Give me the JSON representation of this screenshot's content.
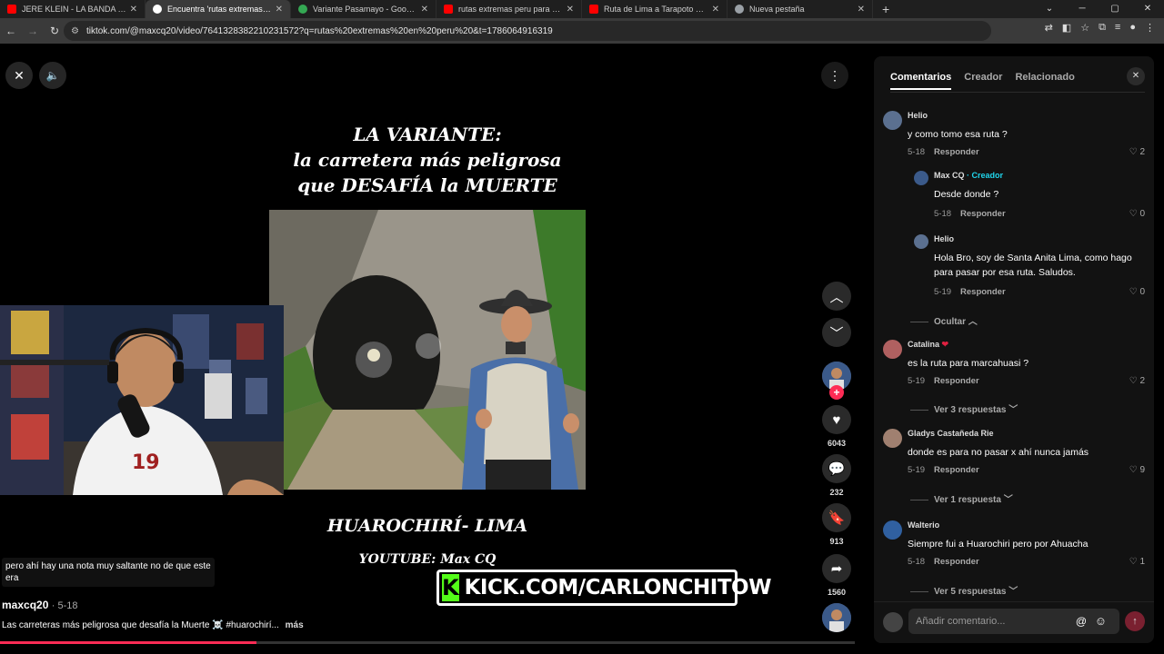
{
  "browser": {
    "tabs": [
      {
        "title": "JERE KLEIN - LA BANDA (Letra/",
        "color": "#ff0000"
      },
      {
        "title": "Encuentra 'rutas extremas en p",
        "color": "#ffffff"
      },
      {
        "title": "Variante Pasamayo - Google M",
        "color": "#34a853"
      },
      {
        "title": "rutas extremas peru para biker",
        "color": "#ff0000"
      },
      {
        "title": "Ruta de Lima a Tarapoto en mo",
        "color": "#ff0000"
      },
      {
        "title": "Nueva pestaña",
        "color": "#9aa0a6"
      }
    ],
    "url": "tiktok.com/@maxcq20/video/7641328382210231572?q=rutas%20extremas%20en%20peru%20&t=1786064916319"
  },
  "video": {
    "title_lines": [
      "LA VARIANTE:",
      "la carretera más peligrosa",
      "que DESAFÍA la MUERTE"
    ],
    "subtitle": "HUAROCHIRÍ- LIMA",
    "youtube": "YOUTUBE: Max CQ",
    "kick_text": "KICK.COM/CARLONCHITOW",
    "kick_icon": "K",
    "overlay_note": "pero ahí hay una nota muy saltante no de que este era",
    "author": "maxcq20",
    "date": "5-18",
    "description": "Las carreteras más peligrosa que desafía la Muerte ☠️ #huarochirí...",
    "more": "más",
    "progress": 0.3
  },
  "actions": {
    "likes": "6043",
    "comments": "232",
    "saves": "913",
    "shares": "1560"
  },
  "panel": {
    "tabs": [
      "Comentarios",
      "Creador",
      "Relacionado"
    ],
    "reply_label": "Responder",
    "comments": [
      {
        "name": "Helio",
        "text": "y como tomo esa ruta ?",
        "date": "5-18",
        "likes": "2"
      },
      {
        "name": "Catalina",
        "text": "es la ruta para marcahuasi ?",
        "date": "5-19",
        "likes": "2"
      },
      {
        "name": "Gladys Castañeda Rie",
        "text": "donde es para no pasar x ahí nunca jamás",
        "date": "5-19",
        "likes": "9"
      },
      {
        "name": "Walterio",
        "text": "Siempre fui a Huarochiri pero por Ahuacha",
        "date": "5-18",
        "likes": "1"
      }
    ],
    "replies": [
      {
        "name": "Max CQ",
        "badge": "· Creador",
        "text": "Desde donde ?",
        "date": "5-18",
        "likes": "0"
      },
      {
        "name": "Helio",
        "text": "Hola Bro, soy de Santa Anita Lima, como hago para pasar por esa ruta. Saludos.",
        "date": "5-19",
        "likes": "0"
      }
    ],
    "toggles": {
      "hide": "Ocultar",
      "view3": "Ver 3 respuestas",
      "view1": "Ver 1 respuesta",
      "view5": "Ver 5 respuestas"
    },
    "input_placeholder": "Añadir comentario...",
    "heart_emoji": "❤"
  },
  "colors": {
    "accent": "#fe2c55",
    "kick_green": "#53fc18",
    "creator_badge": "#20d5ec"
  }
}
